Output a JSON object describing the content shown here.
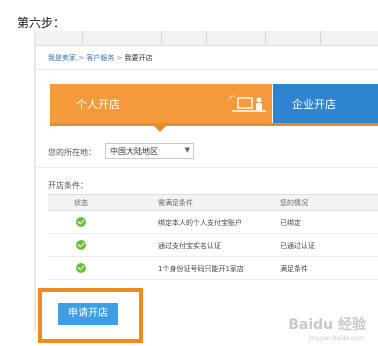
{
  "step_label": "第六步：",
  "topnav": {
    "tabs": [
      "",
      "",
      "",
      "",
      ""
    ]
  },
  "breadcrumb": {
    "home": "我是卖家",
    "sep1": " > ",
    "service": "客户服务",
    "sep2": " > ",
    "current": "我要开店"
  },
  "tabs": {
    "personal": "个人开店",
    "enterprise": "企业开店"
  },
  "region": {
    "label": "您的所在地：",
    "value": "中国大陆地区"
  },
  "conditions": {
    "label": "开店条件：",
    "headers": [
      "状态",
      "需满足条件",
      "您的情况"
    ],
    "rows": [
      {
        "requirement": "绑定本人的个人支付宝账户",
        "status_text": "已绑定"
      },
      {
        "requirement": "通过支付宝实名认证",
        "status_text": "已通过认证"
      },
      {
        "requirement": "1个身份证号码只能开1家店",
        "status_text": "满足条件"
      }
    ]
  },
  "apply_button": "申请开店",
  "colors": {
    "personal_tab": "#f49a3b",
    "enterprise_tab": "#2e84cf",
    "check": "#6cbf3a",
    "apply": "#3d9ee6",
    "highlight": "#f08c1e"
  },
  "watermark": {
    "main": "Baidu 经验",
    "sub": "jingyan.baidu.com"
  }
}
